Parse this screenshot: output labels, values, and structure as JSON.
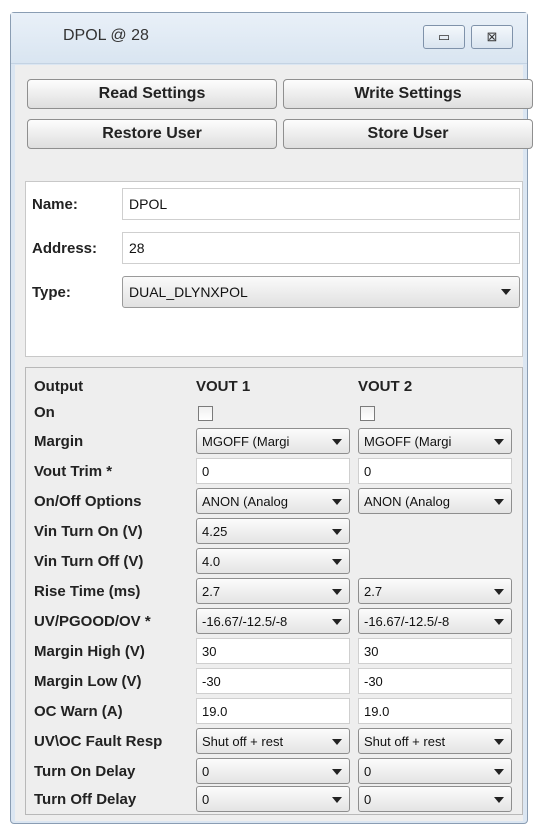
{
  "window": {
    "title": "DPOL @ 28",
    "minimize_glyph": "▭",
    "close_glyph": "⊠"
  },
  "buttons": {
    "read": "Read Settings",
    "write": "Write Settings",
    "restore": "Restore User",
    "store": "Store User"
  },
  "device": {
    "name_label": "Name:",
    "name_value": "DPOL",
    "address_label": "Address:",
    "address_value": "28",
    "type_label": "Type:",
    "type_value": "DUAL_DLYNXPOL"
  },
  "grid": {
    "header_label": "Output",
    "col1": "VOUT 1",
    "col2": "VOUT 2",
    "rows": {
      "on": "On",
      "margin": {
        "label": "Margin",
        "v1": "MGOFF (Margi",
        "v2": "MGOFF (Margi"
      },
      "vout_trim": {
        "label": "Vout Trim *",
        "v1": "0",
        "v2": "0"
      },
      "onoff_options": {
        "label": "On/Off Options",
        "v1": "ANON (Analog",
        "v2": "ANON (Analog"
      },
      "vin_turn_on": {
        "label": "Vin Turn On (V)",
        "v1": "4.25"
      },
      "vin_turn_off": {
        "label": "Vin Turn Off (V)",
        "v1": "4.0"
      },
      "rise_time": {
        "label": "Rise Time (ms)",
        "v1": "2.7",
        "v2": "2.7"
      },
      "uv_pgood_ov": {
        "label": "UV/PGOOD/OV *",
        "v1": "-16.67/-12.5/-8",
        "v2": "-16.67/-12.5/-8"
      },
      "margin_high": {
        "label": "Margin High (V)",
        "v1": "30",
        "v2": "30"
      },
      "margin_low": {
        "label": "Margin Low (V)",
        "v1": "-30",
        "v2": "-30"
      },
      "oc_warn": {
        "label": "OC Warn (A)",
        "v1": "19.0",
        "v2": "19.0"
      },
      "uv_oc_fault": {
        "label": "UV\\OC Fault Resp",
        "v1": "Shut off + rest",
        "v2": "Shut off + rest"
      },
      "turn_on_delay": {
        "label": "Turn On Delay",
        "v1": "0",
        "v2": "0"
      },
      "turn_off_delay": {
        "label": "Turn Off Delay",
        "v1": "0",
        "v2": "0"
      }
    }
  }
}
